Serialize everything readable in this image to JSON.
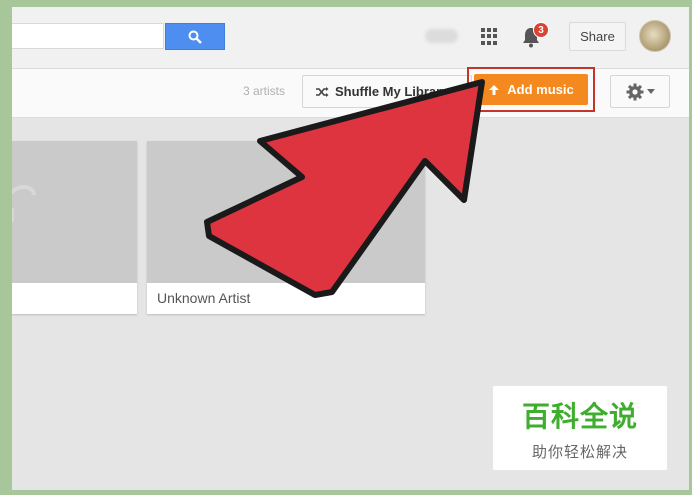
{
  "header": {
    "search_placeholder": "",
    "notification_count": "3",
    "share_label": "Share"
  },
  "toolbar": {
    "artist_count": "3 artists",
    "shuffle_label": "Shuffle My Library",
    "add_music_label": "Add music"
  },
  "library": {
    "cards": [
      {
        "name": ""
      },
      {
        "name": "Unknown Artist"
      }
    ]
  },
  "annotation": {
    "arrow_color": "#dd3440",
    "highlight_color": "#c63327"
  },
  "watermark": {
    "title": "百科全说",
    "subtitle": "助你轻松解决"
  },
  "colors": {
    "accent_orange": "#f48a1f",
    "search_blue": "#4d8ef0",
    "badge_red": "#d84333"
  }
}
